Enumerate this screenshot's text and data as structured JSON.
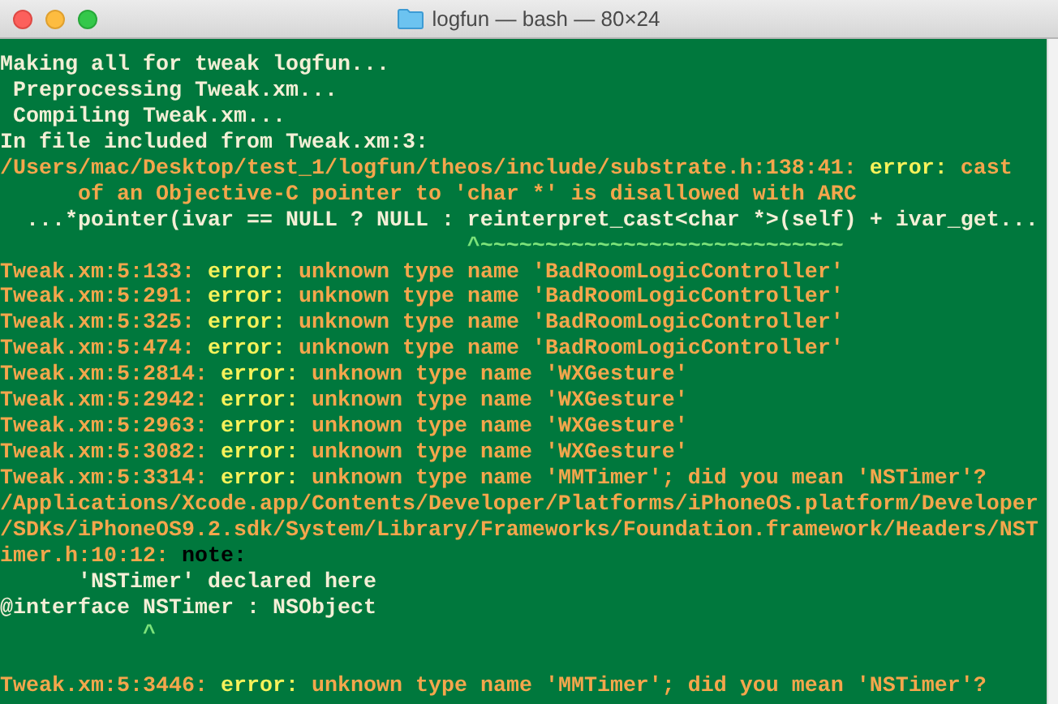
{
  "window": {
    "title": "logfun — bash — 80×24"
  },
  "terminal": {
    "lines": [
      {
        "kind": "text",
        "segments": [
          {
            "kind": "normal",
            "text": "Making all for tweak logfun..."
          }
        ]
      },
      {
        "kind": "text",
        "segments": [
          {
            "kind": "normal",
            "text": " Preprocessing Tweak.xm..."
          }
        ]
      },
      {
        "kind": "text",
        "segments": [
          {
            "kind": "normal",
            "text": " Compiling Tweak.xm..."
          }
        ]
      },
      {
        "kind": "text",
        "segments": [
          {
            "kind": "normal",
            "text": "In file included from Tweak.xm:3:"
          }
        ]
      },
      {
        "kind": "text",
        "segments": [
          {
            "kind": "message",
            "text": "/Users/mac/Desktop/test_1/logfun/theos/include/substrate.h:138:41: "
          },
          {
            "kind": "error",
            "text": "error:"
          },
          {
            "kind": "message",
            "text": " cast"
          }
        ]
      },
      {
        "kind": "text",
        "segments": [
          {
            "kind": "message",
            "text": "      of an Objective-C pointer to 'char *' is disallowed with ARC"
          }
        ]
      },
      {
        "kind": "text",
        "segments": [
          {
            "kind": "normal",
            "text": "  ...*pointer(ivar == NULL ? NULL : reinterpret_cast<char *>(self) + ivar_get..."
          }
        ]
      },
      {
        "kind": "text",
        "segments": [
          {
            "kind": "caret",
            "text": "                                    ^~~~~~~~~~~~~~~~~~~~~~~~~~~~~"
          }
        ]
      },
      {
        "kind": "text",
        "segments": [
          {
            "kind": "message",
            "text": "Tweak.xm:5:133: "
          },
          {
            "kind": "error",
            "text": "error:"
          },
          {
            "kind": "message",
            "text": " unknown type name 'BadRoomLogicController'"
          }
        ]
      },
      {
        "kind": "text",
        "segments": [
          {
            "kind": "message",
            "text": "Tweak.xm:5:291: "
          },
          {
            "kind": "error",
            "text": "error:"
          },
          {
            "kind": "message",
            "text": " unknown type name 'BadRoomLogicController'"
          }
        ]
      },
      {
        "kind": "text",
        "segments": [
          {
            "kind": "message",
            "text": "Tweak.xm:5:325: "
          },
          {
            "kind": "error",
            "text": "error:"
          },
          {
            "kind": "message",
            "text": " unknown type name 'BadRoomLogicController'"
          }
        ]
      },
      {
        "kind": "text",
        "segments": [
          {
            "kind": "message",
            "text": "Tweak.xm:5:474: "
          },
          {
            "kind": "error",
            "text": "error:"
          },
          {
            "kind": "message",
            "text": " unknown type name 'BadRoomLogicController'"
          }
        ]
      },
      {
        "kind": "text",
        "segments": [
          {
            "kind": "message",
            "text": "Tweak.xm:5:2814: "
          },
          {
            "kind": "error",
            "text": "error:"
          },
          {
            "kind": "message",
            "text": " unknown type name 'WXGesture'"
          }
        ]
      },
      {
        "kind": "text",
        "segments": [
          {
            "kind": "message",
            "text": "Tweak.xm:5:2942: "
          },
          {
            "kind": "error",
            "text": "error:"
          },
          {
            "kind": "message",
            "text": " unknown type name 'WXGesture'"
          }
        ]
      },
      {
        "kind": "text",
        "segments": [
          {
            "kind": "message",
            "text": "Tweak.xm:5:2963: "
          },
          {
            "kind": "error",
            "text": "error:"
          },
          {
            "kind": "message",
            "text": " unknown type name 'WXGesture'"
          }
        ]
      },
      {
        "kind": "text",
        "segments": [
          {
            "kind": "message",
            "text": "Tweak.xm:5:3082: "
          },
          {
            "kind": "error",
            "text": "error:"
          },
          {
            "kind": "message",
            "text": " unknown type name 'WXGesture'"
          }
        ]
      },
      {
        "kind": "text",
        "segments": [
          {
            "kind": "message",
            "text": "Tweak.xm:5:3314: "
          },
          {
            "kind": "error",
            "text": "error:"
          },
          {
            "kind": "message",
            "text": " unknown type name 'MMTimer'; did you mean 'NSTimer'?"
          }
        ]
      },
      {
        "kind": "text",
        "segments": [
          {
            "kind": "message",
            "text": "/Applications/Xcode.app/Contents/Developer/Platforms/iPhoneOS.platform/Developer"
          }
        ]
      },
      {
        "kind": "text",
        "segments": [
          {
            "kind": "message",
            "text": "/SDKs/iPhoneOS9.2.sdk/System/Library/Frameworks/Foundation.framework/Headers/NST"
          }
        ]
      },
      {
        "kind": "text",
        "segments": [
          {
            "kind": "message",
            "text": "imer.h:10:12: "
          },
          {
            "kind": "note",
            "text": "note:"
          }
        ]
      },
      {
        "kind": "text",
        "segments": [
          {
            "kind": "normal",
            "text": "      'NSTimer' declared here"
          }
        ]
      },
      {
        "kind": "text",
        "segments": [
          {
            "kind": "normal",
            "text": "@interface NSTimer : NSObject"
          }
        ]
      },
      {
        "kind": "text",
        "segments": [
          {
            "kind": "caret",
            "text": "           ^"
          }
        ]
      },
      {
        "kind": "blank"
      },
      {
        "kind": "text",
        "segments": [
          {
            "kind": "message",
            "text": "Tweak.xm:5:3446: "
          },
          {
            "kind": "error",
            "text": "error:"
          },
          {
            "kind": "message",
            "text": " unknown type name 'MMTimer'; did you mean 'NSTimer'?"
          }
        ]
      }
    ]
  }
}
